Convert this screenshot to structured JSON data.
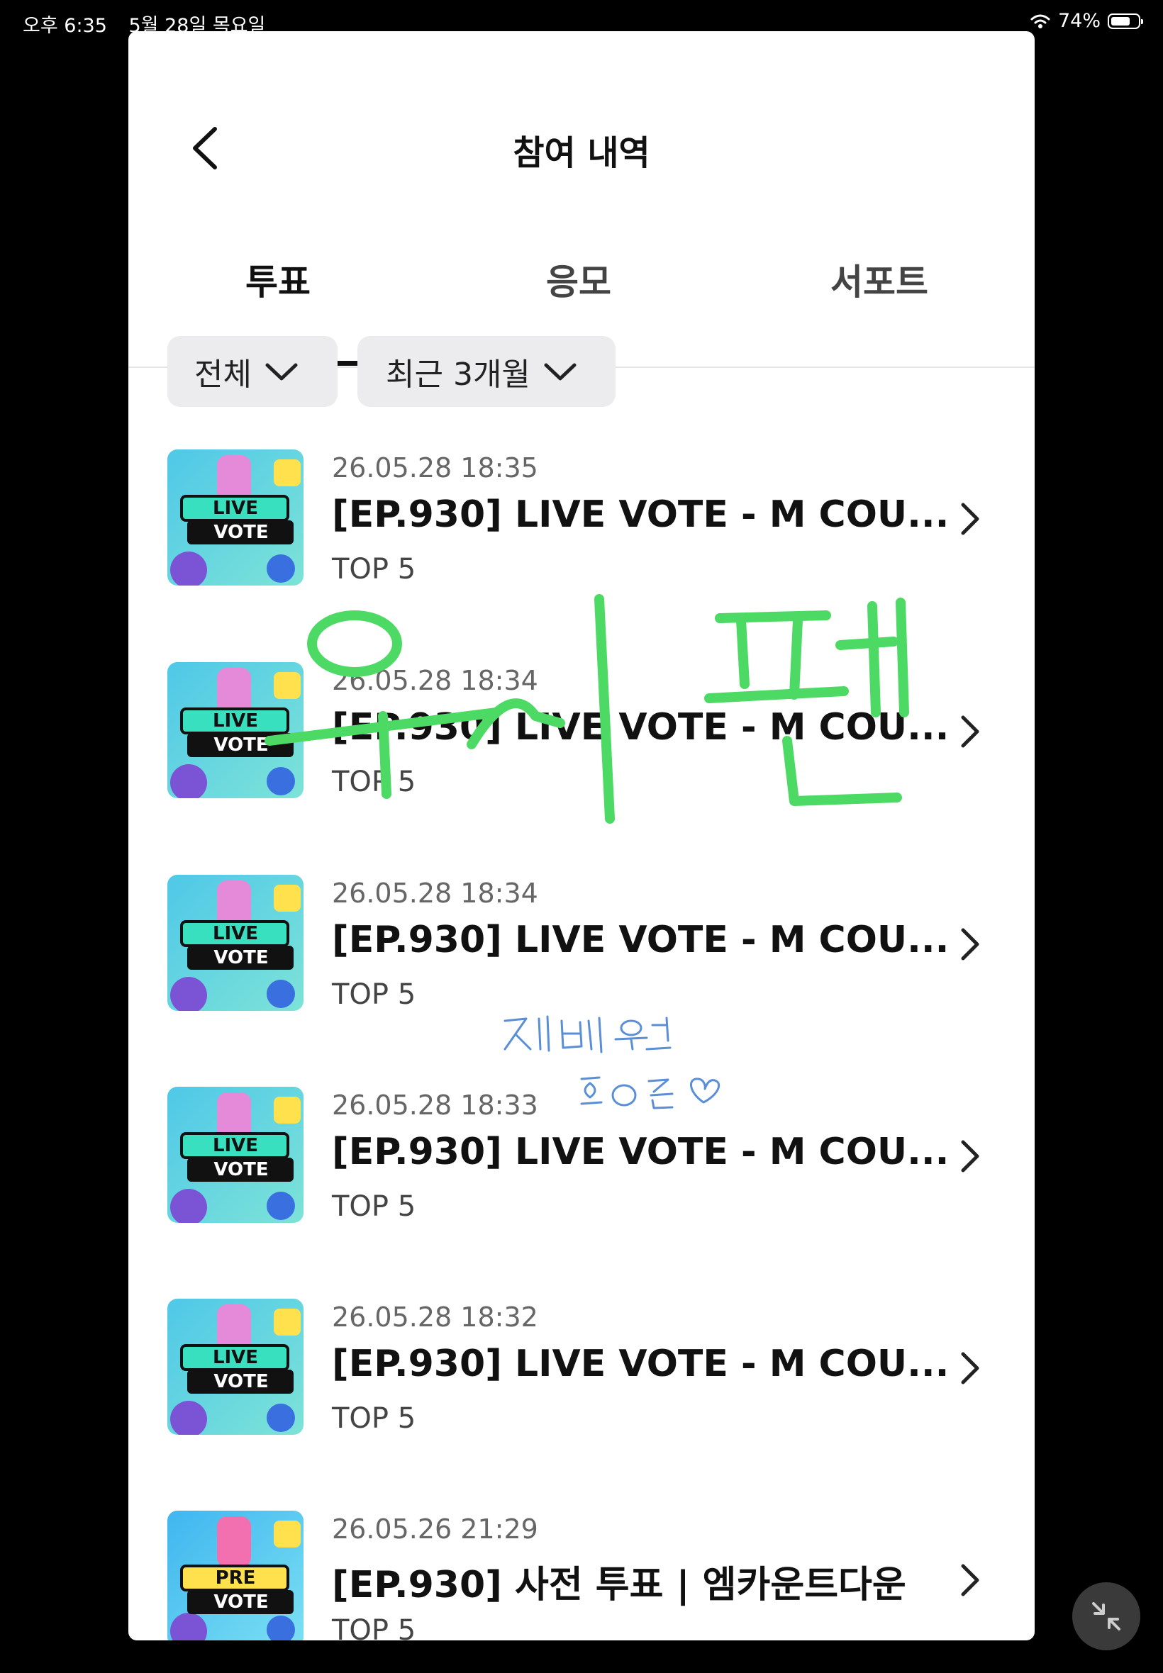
{
  "status_bar": {
    "time": "오후 6:35",
    "date": "5월 28일 목요일",
    "battery": "74%",
    "battery_level": 0.74
  },
  "header": {
    "title": "참여 내역"
  },
  "tabs": [
    {
      "label": "투표",
      "active": true
    },
    {
      "label": "응모",
      "active": false
    },
    {
      "label": "서포트",
      "active": false
    }
  ],
  "filters": [
    {
      "label": "전체"
    },
    {
      "label": "최근 3개월"
    }
  ],
  "items": [
    {
      "date": "26.05.28 18:35",
      "title": "[EP.930] LIVE VOTE - M COU...",
      "rank": "TOP 5",
      "thumb": {
        "line1": "LIVE",
        "line2": "VOTE"
      }
    },
    {
      "date": "26.05.28 18:34",
      "title": "[EP.930] LIVE VOTE - M COU...",
      "rank": "TOP 5",
      "thumb": {
        "line1": "LIVE",
        "line2": "VOTE"
      }
    },
    {
      "date": "26.05.28 18:34",
      "title": "[EP.930] LIVE VOTE - M COU...",
      "rank": "TOP 5",
      "thumb": {
        "line1": "LIVE",
        "line2": "VOTE"
      }
    },
    {
      "date": "26.05.28 18:33",
      "title": "[EP.930] LIVE VOTE - M COU...",
      "rank": "TOP 5",
      "thumb": {
        "line1": "LIVE",
        "line2": "VOTE"
      }
    },
    {
      "date": "26.05.28 18:32",
      "title": "[EP.930] LIVE VOTE - M COU...",
      "rank": "TOP 5",
      "thumb": {
        "line1": "LIVE",
        "line2": "VOTE"
      }
    },
    {
      "date": "26.05.26 21:29",
      "title": "[EP.930] 사전 투표 | 엠카운트다운",
      "rank": "TOP 5",
      "thumb": {
        "line1": "PRE",
        "line2": "VOTE"
      }
    }
  ],
  "handwriting": {
    "green": "우시 팬",
    "blue_line1": "제베원",
    "blue_line2": "하온 ♡"
  },
  "icons": {
    "back": "chevron-left-icon",
    "item_arrow": "chevron-right-icon",
    "filter_dropdown": "chevron-down-icon",
    "wifi": "wifi-icon",
    "battery": "battery-icon",
    "minimize": "minimize-arrows-icon"
  },
  "colors": {
    "handwriting_green": "#4cd964",
    "handwriting_blue": "#5a8fd8",
    "card_bg": "#ffffff",
    "screen_bg": "#000000",
    "filter_bg": "#ececee"
  }
}
